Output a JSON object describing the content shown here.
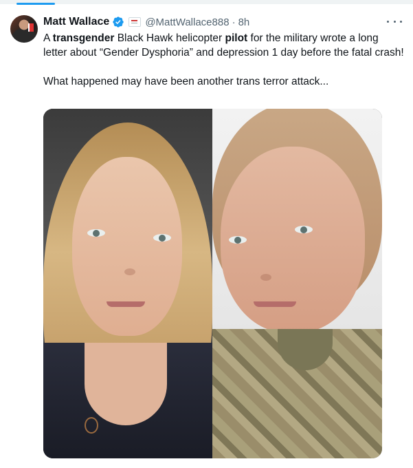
{
  "tweet": {
    "author_name": "Matt Wallace",
    "handle": "@MattWallace888",
    "separator": "·",
    "time": "8h",
    "verified": true,
    "text_parts": {
      "p1_a": "A ",
      "p1_b": "transgender",
      "p1_c": " Black Hawk helicopter ",
      "p1_d": "pilot",
      "p1_e": " for the military wrote a long letter about “Gender Dysphoria” and depression 1 day before the fatal crash!",
      "p2": "What happened may have been another trans terror attack..."
    },
    "icons": [
      "verified-badge-icon",
      "affiliation-flag-icon",
      "more-options-icon"
    ]
  },
  "colors": {
    "text": "#0f1419",
    "secondary": "#536471",
    "accent": "#1d9bf0"
  }
}
